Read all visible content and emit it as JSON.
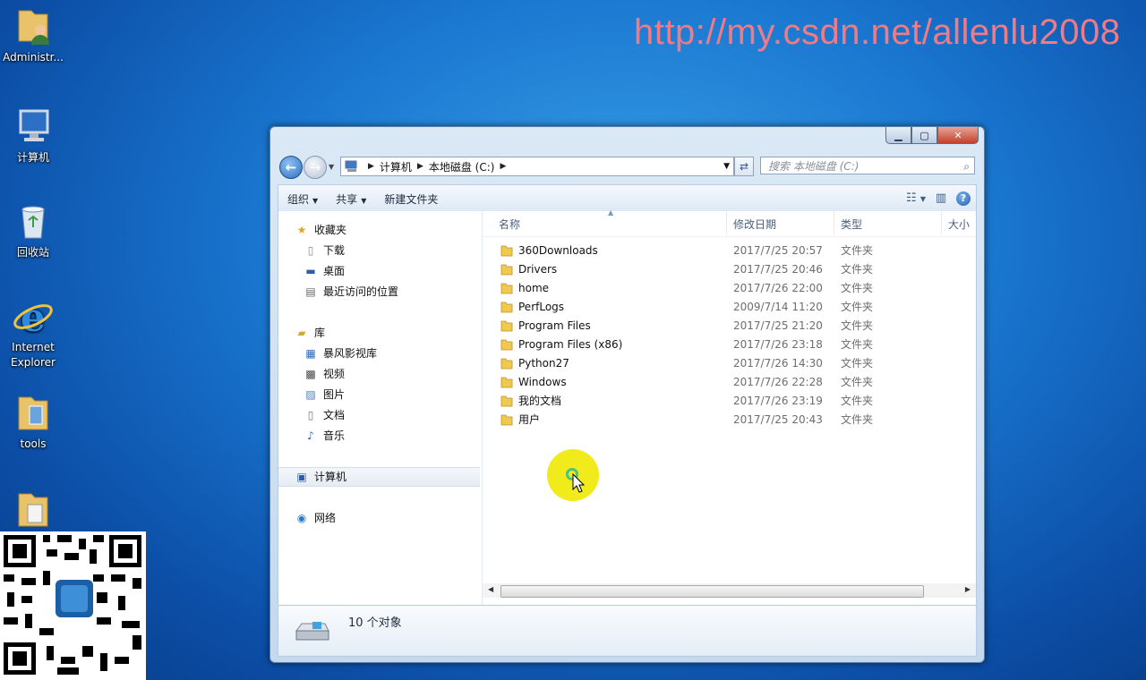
{
  "watermark": "http://my.csdn.net/allenlu2008",
  "desktop": {
    "icons": [
      {
        "label": "Administr...",
        "icon": "user-folder-icon"
      },
      {
        "label": "计算机",
        "icon": "computer-icon"
      },
      {
        "label": "回收站",
        "icon": "recycle-bin-icon"
      },
      {
        "label": "Internet Explorer",
        "icon": "ie-icon"
      },
      {
        "label": "tools",
        "icon": "folder-icon"
      }
    ]
  },
  "window": {
    "address": {
      "computer": "计算机",
      "drive": "本地磁盘 (C:)"
    },
    "search_placeholder": "搜索 本地磁盘 (C:)",
    "toolbar": {
      "organize": "组织",
      "share": "共享",
      "new_folder": "新建文件夹"
    },
    "nav": {
      "favorites": "收藏夹",
      "downloads": "下载",
      "desktop": "桌面",
      "recent": "最近访问的位置",
      "libraries": "库",
      "storm": "暴风影视库",
      "videos": "视频",
      "pictures": "图片",
      "documents": "文档",
      "music": "音乐",
      "computer": "计算机",
      "network": "网络"
    },
    "columns": {
      "name": "名称",
      "date": "修改日期",
      "type": "类型",
      "size": "大小"
    },
    "files": [
      {
        "name": "360Downloads",
        "date": "2017/7/25 20:57",
        "type": "文件夹"
      },
      {
        "name": "Drivers",
        "date": "2017/7/25 20:46",
        "type": "文件夹"
      },
      {
        "name": "home",
        "date": "2017/7/26 22:00",
        "type": "文件夹"
      },
      {
        "name": "PerfLogs",
        "date": "2009/7/14 11:20",
        "type": "文件夹"
      },
      {
        "name": "Program Files",
        "date": "2017/7/25 21:20",
        "type": "文件夹"
      },
      {
        "name": "Program Files (x86)",
        "date": "2017/7/26 23:18",
        "type": "文件夹"
      },
      {
        "name": "Python27",
        "date": "2017/7/26 14:30",
        "type": "文件夹"
      },
      {
        "name": "Windows",
        "date": "2017/7/26 22:28",
        "type": "文件夹"
      },
      {
        "name": "我的文档",
        "date": "2017/7/26 23:19",
        "type": "文件夹"
      },
      {
        "name": "用户",
        "date": "2017/7/25 20:43",
        "type": "文件夹"
      }
    ],
    "status": "10 个对象"
  }
}
